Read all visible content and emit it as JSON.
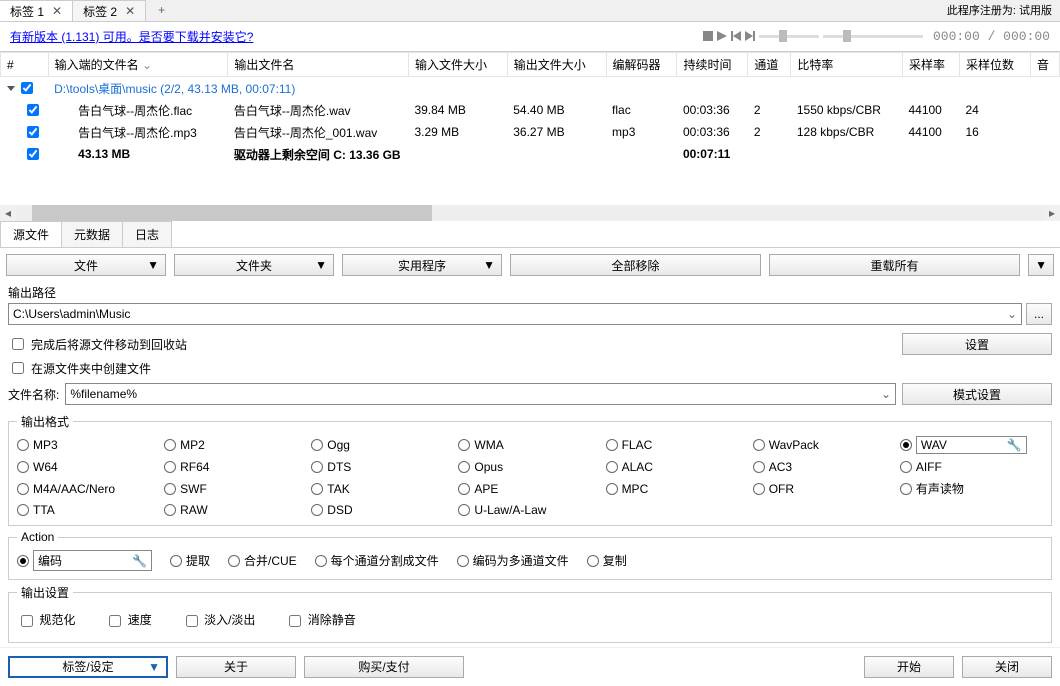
{
  "registration": "此程序注册为: 试用版",
  "tabs": [
    {
      "label": "标签 1"
    },
    {
      "label": "标签 2"
    }
  ],
  "update_link": "有新版本 (1.131) 可用。是否要下载并安装它?",
  "time_display": "000:00 / 000:00",
  "columns": {
    "num": "#",
    "input_name": "输入端的文件名",
    "output_name": "输出文件名",
    "input_size": "输入文件大小",
    "output_size": "输出文件大小",
    "codec": "编解码器",
    "duration": "持续时间",
    "channels": "通道",
    "bitrate": "比特率",
    "sample_rate": "采样率",
    "sample_bits": "采样位数",
    "audio": "音"
  },
  "group": "D:\\tools\\桌面\\music (2/2, 43.13 MB, 00:07:11)",
  "rows": [
    {
      "in": "告白气球--周杰伦.flac",
      "out": "告白气球--周杰伦.wav",
      "insize": "39.84 MB",
      "outsize": "54.40 MB",
      "codec": "flac",
      "dur": "00:03:36",
      "ch": "2",
      "br": "1550 kbps/CBR",
      "sr": "44100",
      "bits": "24"
    },
    {
      "in": "告白气球--周杰伦.mp3",
      "out": "告白气球--周杰伦_001.wav",
      "insize": "3.29 MB",
      "outsize": "36.27 MB",
      "codec": "mp3",
      "dur": "00:03:36",
      "ch": "2",
      "br": "128 kbps/CBR",
      "sr": "44100",
      "bits": "16"
    }
  ],
  "summary": {
    "size": "43.13 MB",
    "free": "驱动器上剩余空间 C: 13.36 GB",
    "dur": "00:07:11"
  },
  "subtabs": {
    "source": "源文件",
    "meta": "元数据",
    "log": "日志"
  },
  "toolbar": {
    "file": "文件",
    "folder": "文件夹",
    "utility": "实用程序",
    "remove_all": "全部移除",
    "reload_all": "重载所有"
  },
  "output_path_label": "输出路径",
  "output_path": "C:\\Users\\admin\\Music",
  "browse": "...",
  "chk_recycle": "完成后将源文件移动到回收站",
  "chk_create_in_src": "在源文件夹中创建文件",
  "settings_btn": "设置",
  "filename_label": "文件名称:",
  "filename_pattern": "%filename%",
  "pattern_settings_btn": "模式设置",
  "format_label": "输出格式",
  "formats": {
    "r0": [
      "MP3",
      "MP2",
      "Ogg",
      "WMA",
      "FLAC",
      "WavPack",
      "WAV"
    ],
    "r1": [
      "W64",
      "RF64",
      "DTS",
      "Opus",
      "ALAC",
      "AC3",
      "AIFF"
    ],
    "r2": [
      "M4A/AAC/Nero",
      "SWF",
      "TAK",
      "APE",
      "MPC",
      "OFR",
      "有声读物"
    ],
    "r3": [
      "TTA",
      "RAW",
      "DSD",
      "U-Law/A-Law",
      "",
      "",
      ""
    ]
  },
  "selected_format": "WAV",
  "action_label": "Action",
  "actions": {
    "encode": "编码",
    "extract": "提取",
    "merge": "合并/CUE",
    "split": "每个通道分割成文件",
    "multi": "编码为多通道文件",
    "copy": "复制"
  },
  "out_settings_label": "输出设置",
  "out_checks": {
    "normalize": "规范化",
    "speed": "速度",
    "fade": "淡入/淡出",
    "silence": "消除静音"
  },
  "bottom": {
    "tag_settings": "标签/设定",
    "about": "关于",
    "buy": "购买/支付",
    "start": "开始",
    "close": "关闭"
  }
}
